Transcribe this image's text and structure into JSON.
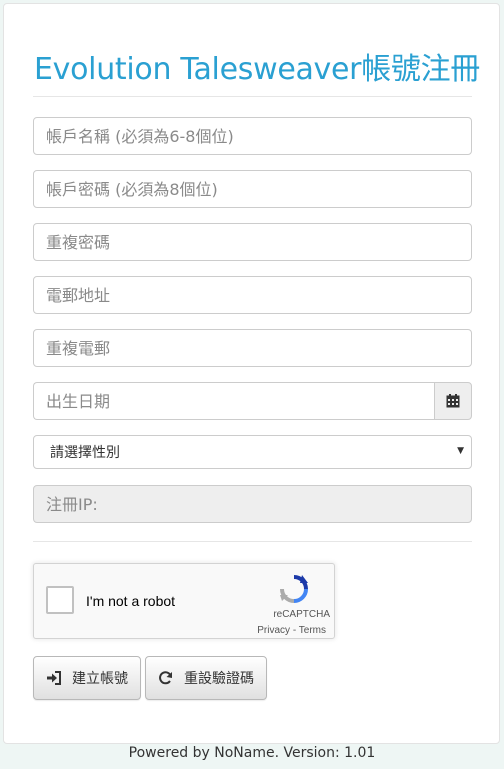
{
  "page": {
    "title": "Evolution Talesweaver帳號注冊"
  },
  "form": {
    "account_placeholder": "帳戶名稱 (必須為6-8個位)",
    "password_placeholder": "帳戶密碼 (必須為8個位)",
    "repeat_password_placeholder": "重複密碼",
    "email_placeholder": "電郵地址",
    "repeat_email_placeholder": "重複電郵",
    "birthdate_placeholder": "出生日期",
    "gender_select_value": "請選擇性別",
    "ip_placeholder": "注冊IP:"
  },
  "captcha": {
    "label": "I'm not a robot",
    "brand": "reCAPTCHA",
    "privacy": "Privacy",
    "separator": " - ",
    "terms": "Terms"
  },
  "buttons": {
    "create_label": "建立帳號",
    "reset_label": "重設驗證碼"
  },
  "footer": {
    "text": "Powered by NoName. Version: 1.01"
  },
  "icons": {
    "calendar": "calendar-icon",
    "login": "sign-in-icon",
    "refresh": "refresh-icon"
  },
  "colors": {
    "title": "#2aa0d2",
    "background": "#eef6f4"
  }
}
